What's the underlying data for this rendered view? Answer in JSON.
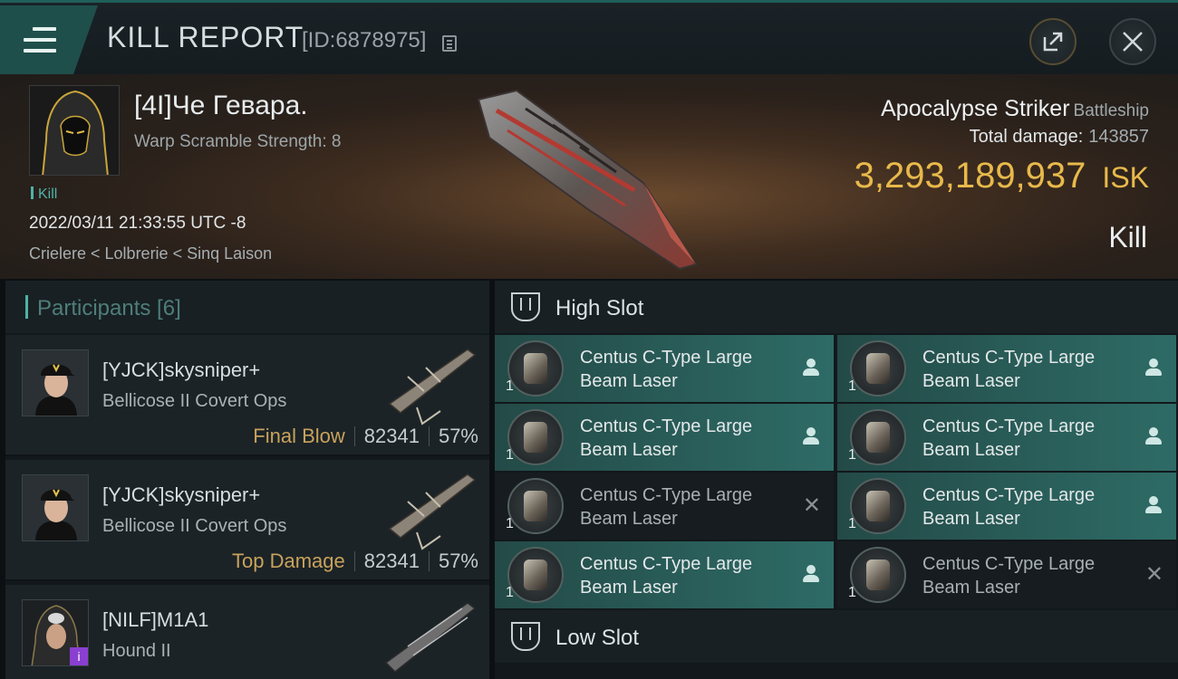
{
  "header": {
    "title": "KILL REPORT",
    "report_id": "[ID:6878975]",
    "share_icon": "share-icon",
    "close_icon": "close-icon"
  },
  "victim": {
    "pilot_name": "[4I]Че Гевара.",
    "warp_scramble": "Warp Scramble Strength: 8",
    "kill_tag": "Kill",
    "datetime": "2022/03/11 21:33:55 UTC -8",
    "location": "Crielere < Lolbrerie < Sinq Laison",
    "ship_name": "Apocalypse Striker",
    "ship_class": "Battleship",
    "total_damage_label": "Total damage:",
    "total_damage_value": "143857",
    "isk_value": "3,293,189,937",
    "isk_unit": "ISK",
    "outcome": "Kill"
  },
  "participants": {
    "title": "Participants [6]",
    "list": [
      {
        "name": "[YJCK]skysniper+",
        "ship": "Bellicose II Covert Ops",
        "tag": "Final Blow",
        "damage": "82341",
        "percent": "57%"
      },
      {
        "name": "[YJCK]skysniper+",
        "ship": "Bellicose II Covert Ops",
        "tag": "Top Damage",
        "damage": "82341",
        "percent": "57%"
      },
      {
        "name": "[NILF]M1A1",
        "ship": "Hound II",
        "tag": "",
        "damage": "",
        "percent": "",
        "badge": "i"
      }
    ]
  },
  "slots": {
    "high_title": "High Slot",
    "low_title": "Low Slot",
    "high_modules": [
      {
        "name": "Centus C-Type Large Beam Laser",
        "qty": "1",
        "state": "dropped"
      },
      {
        "name": "Centus C-Type Large Beam Laser",
        "qty": "1",
        "state": "dropped"
      },
      {
        "name": "Centus C-Type Large Beam Laser",
        "qty": "1",
        "state": "dropped"
      },
      {
        "name": "Centus C-Type Large Beam Laser",
        "qty": "1",
        "state": "dropped"
      },
      {
        "name": "Centus C-Type Large Beam Laser",
        "qty": "1",
        "state": "destroyed"
      },
      {
        "name": "Centus C-Type Large Beam Laser",
        "qty": "1",
        "state": "dropped"
      },
      {
        "name": "Centus C-Type Large Beam Laser",
        "qty": "1",
        "state": "dropped"
      },
      {
        "name": "Centus C-Type Large Beam Laser",
        "qty": "1",
        "state": "destroyed"
      }
    ]
  },
  "colors": {
    "accent_teal": "#4fb2a8",
    "isk_gold": "#e8b94b",
    "tag_gold": "#c9a25b",
    "dropped_bg": "#2e6b66",
    "destroyed_bg": "#161c1f"
  }
}
